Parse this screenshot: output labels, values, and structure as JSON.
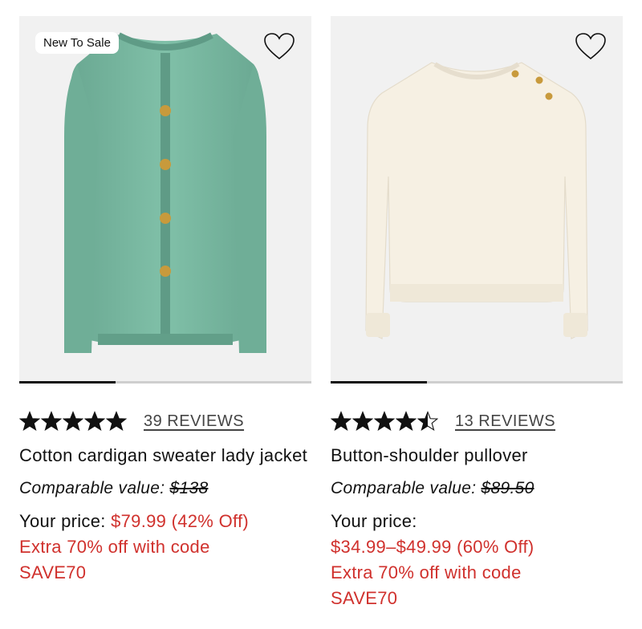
{
  "products": [
    {
      "badge": "New To Sale",
      "rating_value": 5,
      "reviews_label": "39 REVIEWS",
      "name": "Cotton cardigan sweater lady jacket",
      "comparable_label": "Comparable value:",
      "comparable_price": "$138",
      "your_price_label": "Your price:",
      "sale_price": "$79.99 (42% Off)",
      "promo_line1": "Extra 70% off with code",
      "promo_line2": "SAVE70",
      "carousel_progress_pct": 33,
      "garment_color": "#78b8a0"
    },
    {
      "badge": "",
      "rating_value": 4.5,
      "reviews_label": "13 REVIEWS",
      "name": "Button-shoulder pullover",
      "comparable_label": "Comparable value:",
      "comparable_price": "$89.50",
      "your_price_label": "Your price:",
      "sale_price": "$34.99–$49.99 (60% Off)",
      "promo_line1": "Extra 70% off with code",
      "promo_line2": "SAVE70",
      "carousel_progress_pct": 33,
      "garment_color": "#f6f0e3"
    }
  ],
  "colors": {
    "sale_red": "#d0312d",
    "text": "#111111",
    "image_bg": "#f1f1f1"
  },
  "icons": [
    "heart-icon",
    "star-icon"
  ]
}
